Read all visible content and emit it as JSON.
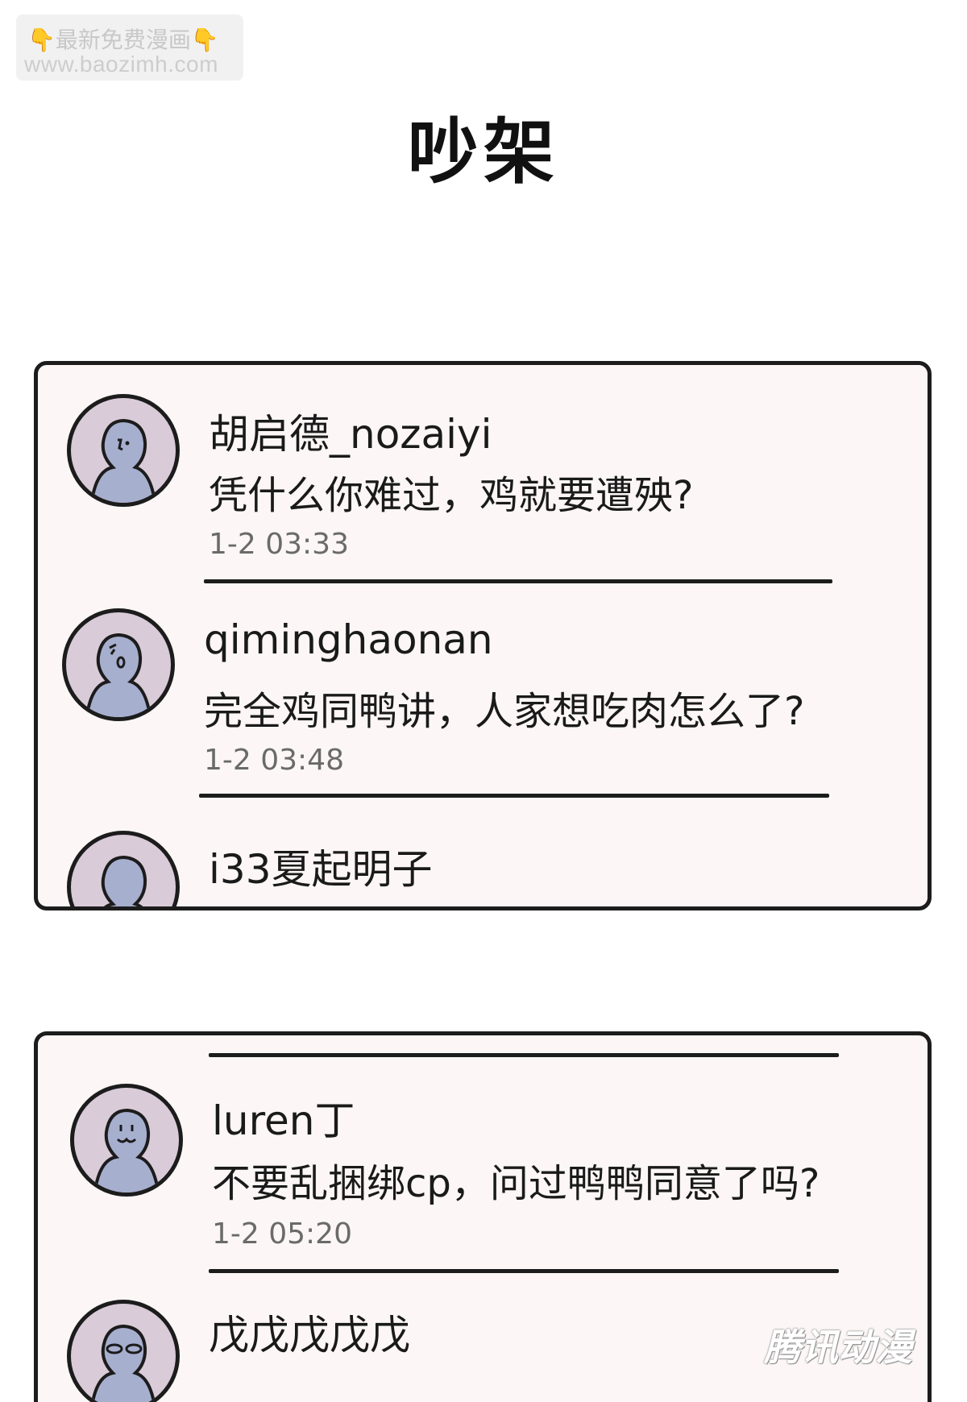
{
  "watermark": {
    "line1": "最新免费漫画",
    "line2": "www.baozimh.com",
    "hand_glyph": "👇"
  },
  "title": "吵架",
  "panels": [
    {
      "comments": [
        {
          "username": "胡启德_nozaiyi",
          "text": "凭什么你难过，鸡就要遭殃?",
          "time": "1-2 03:33"
        },
        {
          "username": "qiminghaonan",
          "text": "完全鸡同鸭讲，人家想吃肉怎么了?",
          "time": "1-2 03:48"
        },
        {
          "username": "i33夏起明子",
          "text": "",
          "time": ""
        }
      ]
    },
    {
      "comments": [
        {
          "username": "luren丁",
          "text": "不要乱捆绑cp，问过鸭鸭同意了吗?",
          "time": "1-2 05:20"
        },
        {
          "username": "戊戊戊戊戊",
          "text": "",
          "time": ""
        }
      ]
    }
  ],
  "brand": "腾讯动漫",
  "colors": {
    "panel_bg": "#fcf6f6",
    "avatar_ring": "#d9cbd8",
    "figure": "#a7afcf",
    "outline": "#1c1c1c"
  }
}
